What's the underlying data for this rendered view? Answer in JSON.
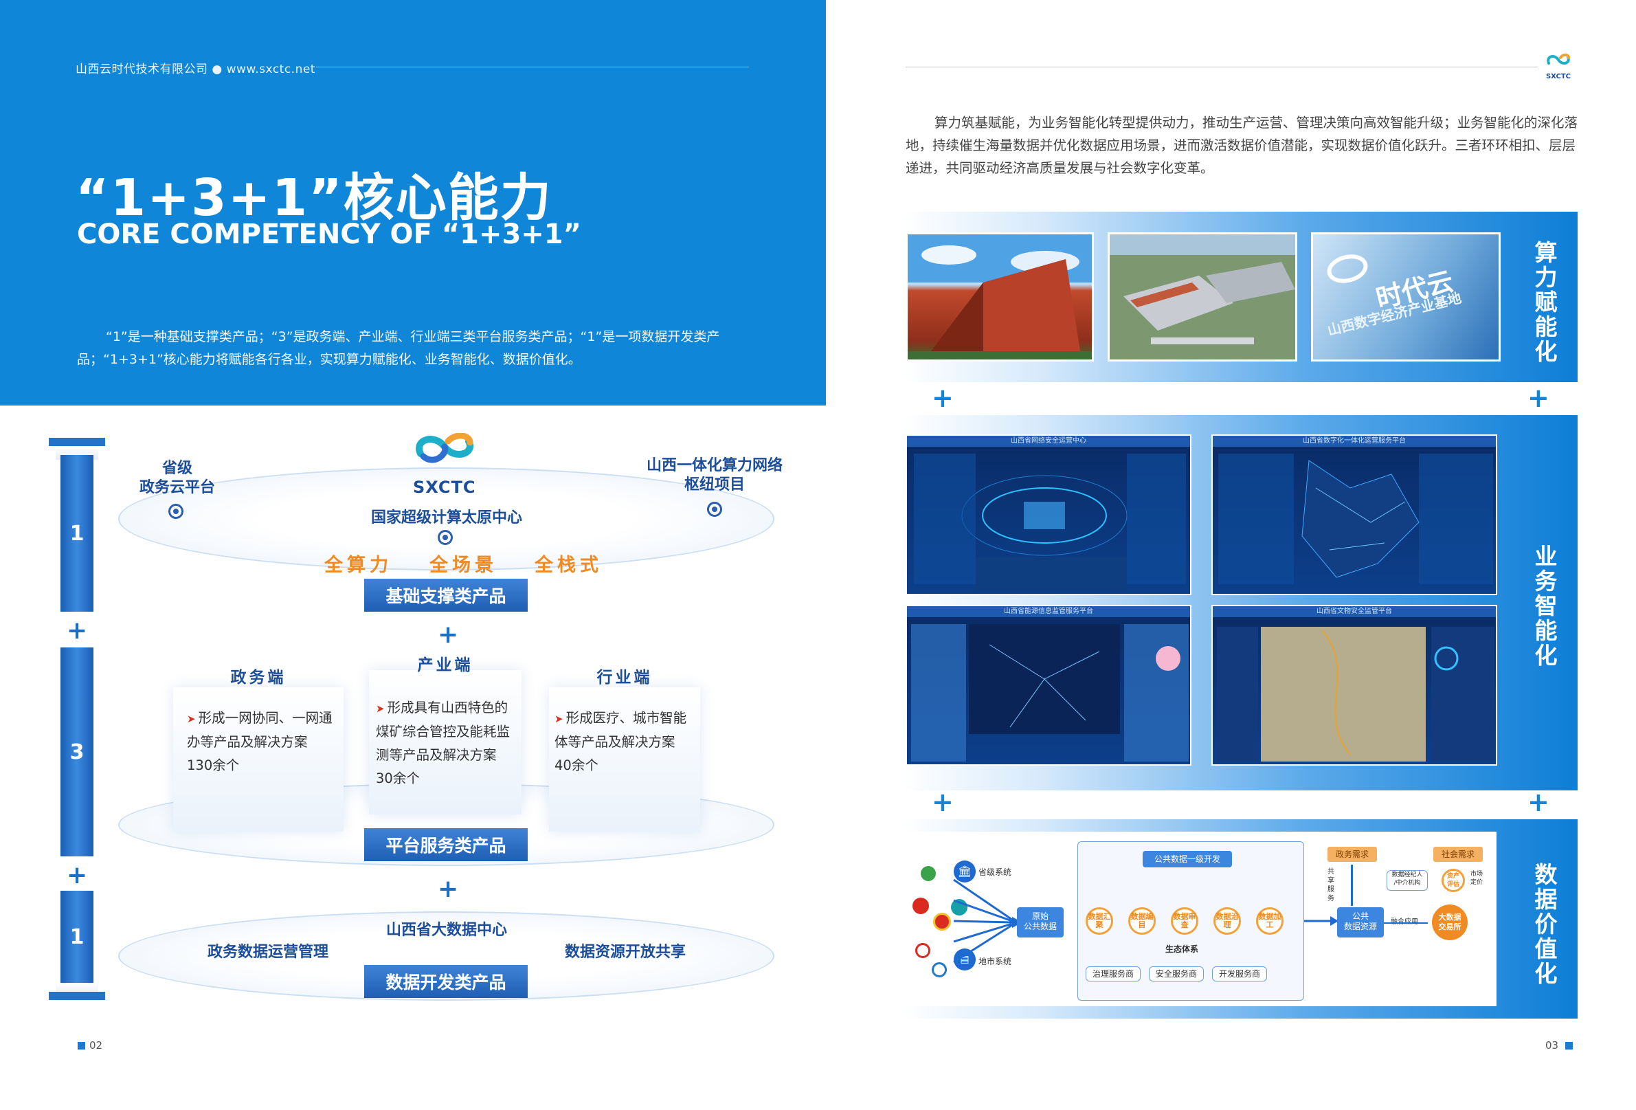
{
  "left": {
    "header": "山西云时代技术有限公司 ● www.sxctc.net",
    "title_cn": "“1+3+1”核心能力",
    "title_en": "CORE COMPETENCY OF “1+3+1”",
    "intro": "“1”是一种基础支撑类产品；“3”是政务端、产业端、行业端三类平台服务类产品；“1”是一项数据开发类产品；“1+3+1”核心能力将赋能各行各业，实现算力赋能化、业务智能化、数据价值化。",
    "bars": [
      "1",
      "3",
      "1"
    ],
    "plus": "+",
    "tier1": {
      "logo_text": "SXCTC",
      "left_label": "省级\n政务云平台",
      "right_label": "山西一体化算力网络\n枢纽项目",
      "center_label": "国家超级计算太原中心",
      "highlights": [
        "全算力",
        "全场景",
        "全栈式"
      ],
      "tag": "基础支撑类产品"
    },
    "tier2": {
      "cards": [
        {
          "head": "政务端",
          "text": "形成一网协同、一网通办等产品及解决方案130余个"
        },
        {
          "head": "产业端",
          "text": "形成具有山西特色的煤矿综合管控及能耗监测等产品及解决方案30余个"
        },
        {
          "head": "行业端",
          "text": "形成医疗、城市智能体等产品及解决方案40余个"
        }
      ],
      "tag": "平台服务类产品"
    },
    "tier3": {
      "center_label": "山西省大数据中心",
      "left_label": "政务数据运营管理",
      "right_label": "数据资源开放共享",
      "tag": "数据开发类产品"
    },
    "page_number": "02"
  },
  "right": {
    "logo_text": "SXCTC",
    "paragraph": "算力筑基赋能，为业务智能化转型提供动力，推动生产运营、管理决策向高效智能升级；业务智能化的深化落地，持续催生海量数据并优化数据应用场景，进而激活数据价值潜能，实现数据价值化跃升。三者环环相扣、层层递进，共同驱动经济高质量发展与社会数字化变革。",
    "bands": [
      {
        "label": "算力赋能化"
      },
      {
        "label": "业务智能化"
      },
      {
        "label": "数据价值化"
      }
    ],
    "photo3_text": "时代云",
    "photo3_subtext": "山西数字经济产业基地",
    "dashboards": [
      "山西省网络安全运营中心",
      "山西省数字化一体化运营服务平台",
      "山西省能源信息监管服务平台",
      "山西省文物安全监管平台"
    ],
    "flow": {
      "sources": [
        "省级系统",
        "地市系统"
      ],
      "raw": "原始\n公共数据",
      "dev_title": "公共数据一级开发",
      "steps": [
        "数据汇聚",
        "数据编目",
        "数据审查",
        "数据治理",
        "数据加工"
      ],
      "eco_title": "生态体系",
      "eco_items": [
        "治理服务商",
        "安全服务商",
        "开发服务商"
      ],
      "resource": "公共\n数据资源",
      "gov_need": "政务需求",
      "share": "共享服务",
      "social_need": "社会需求",
      "broker": "数据经纪人\n/中介机构",
      "asset": "资产\n评估",
      "pricing": "市场\n定价",
      "fusion": "融合应用",
      "exchange": "大数据\n交易所"
    },
    "page_number": "03"
  },
  "colors": {
    "brand_blue": "#0f86d8",
    "dark_blue": "#1c4e9a",
    "orange": "#f08a22"
  }
}
